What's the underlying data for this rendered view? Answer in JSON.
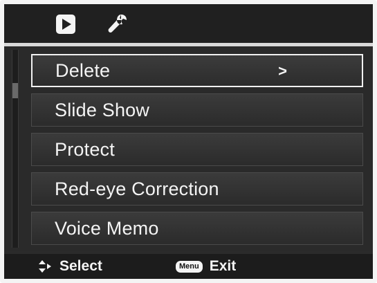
{
  "topbar": {
    "icons": [
      "playback-icon",
      "wrench-icon"
    ]
  },
  "menu": {
    "items": [
      {
        "label": "Delete",
        "selected": true,
        "arrow": ">"
      },
      {
        "label": "Slide Show",
        "selected": false
      },
      {
        "label": "Protect",
        "selected": false
      },
      {
        "label": "Red-eye Correction",
        "selected": false
      },
      {
        "label": "Voice Memo",
        "selected": false
      }
    ]
  },
  "footer": {
    "select_label": "Select",
    "menu_key": "Menu",
    "exit_label": "Exit"
  },
  "colors": {
    "background": "#2b2b2b",
    "text": "#f4f4f4",
    "highlight_border": "#f1f1f1"
  }
}
